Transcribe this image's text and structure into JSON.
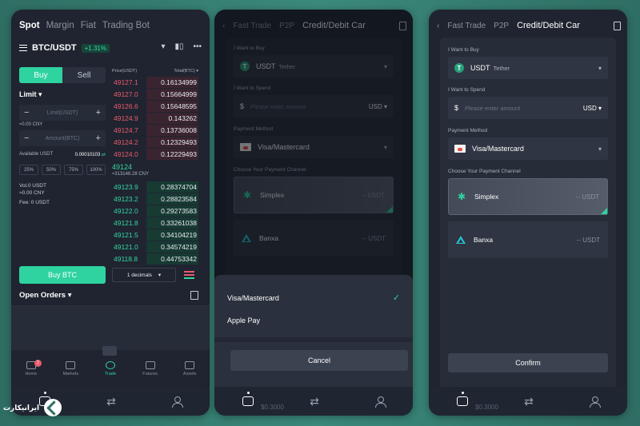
{
  "phone1": {
    "nav_tabs": [
      "Spot",
      "Margin",
      "Fiat",
      "Trading Bot"
    ],
    "pair": "BTC/USDT",
    "change": "+1.31%",
    "buy_label": "Buy",
    "sell_label": "Sell",
    "order_type": "Limit",
    "limit_placeholder": "Limit(USDT)",
    "limit_cny": "≈0.00 CNY",
    "amount_placeholder": "Amount(BTC)",
    "available_label": "Available USDT",
    "available_value": "0.00010103",
    "percents": [
      "25%",
      "50%",
      "75%",
      "100%"
    ],
    "vol_label": "Vol.0 USDT",
    "vol_cny": "≈0.00 CNY",
    "fee_label": "Fee:  0 USDT",
    "orderbook": {
      "price_header": "Price(USDT)",
      "total_header": "Total(BTC)",
      "asks": [
        {
          "price": "49127.1",
          "amount": "0.16134999"
        },
        {
          "price": "49127.0",
          "amount": "0.15664999"
        },
        {
          "price": "49126.6",
          "amount": "0.15648595"
        },
        {
          "price": "49124.9",
          "amount": "0.143262"
        },
        {
          "price": "49124.7",
          "amount": "0.13736008"
        },
        {
          "price": "49124.2",
          "amount": "0.12329493"
        },
        {
          "price": "49124.0",
          "amount": "0.12229493"
        }
      ],
      "mid_price": "49124",
      "mid_cny": "≈313146.28 CNY",
      "bids": [
        {
          "price": "49123.9",
          "amount": "0.28374704"
        },
        {
          "price": "49123.2",
          "amount": "0.28823584"
        },
        {
          "price": "49122.0",
          "amount": "0.29273583"
        },
        {
          "price": "49121.8",
          "amount": "0.33261038"
        },
        {
          "price": "49121.5",
          "amount": "0.34104219"
        },
        {
          "price": "49121.0",
          "amount": "0.34574219"
        },
        {
          "price": "49118.8",
          "amount": "0.44753342"
        }
      ]
    },
    "buy_btn": "Buy BTC",
    "decimals": "1 decimals",
    "open_orders": "Open Orders",
    "tabbar": [
      {
        "label": "Home",
        "badge": "7"
      },
      {
        "label": "Markets"
      },
      {
        "label": "Trade"
      },
      {
        "label": "Futures"
      },
      {
        "label": "Assets"
      }
    ]
  },
  "credit": {
    "tabs": [
      "Fast Trade",
      "P2P",
      "Credit/Debit Car"
    ],
    "want_buy_label": "I Want to Buy",
    "coin": "USDT",
    "coin_name": "Tether",
    "want_spend_label": "I Want to Spend",
    "spend_placeholder": "Please enter amount",
    "currency": "USD",
    "payment_method_label": "Payment Method",
    "payment_method": "Visa/Mastercard",
    "channel_label": "Choose Your Payment Channel",
    "channels": [
      {
        "name": "Simplex",
        "amount": "-- USDT"
      },
      {
        "name": "Banxa",
        "amount": "-- USDT"
      }
    ],
    "sheet_options": [
      "Visa/Mastercard",
      "Apple Pay"
    ],
    "cancel": "Cancel",
    "confirm": "Confirm",
    "ghost_value": "$0.3000"
  },
  "watermark": "ایرانیکارت"
}
